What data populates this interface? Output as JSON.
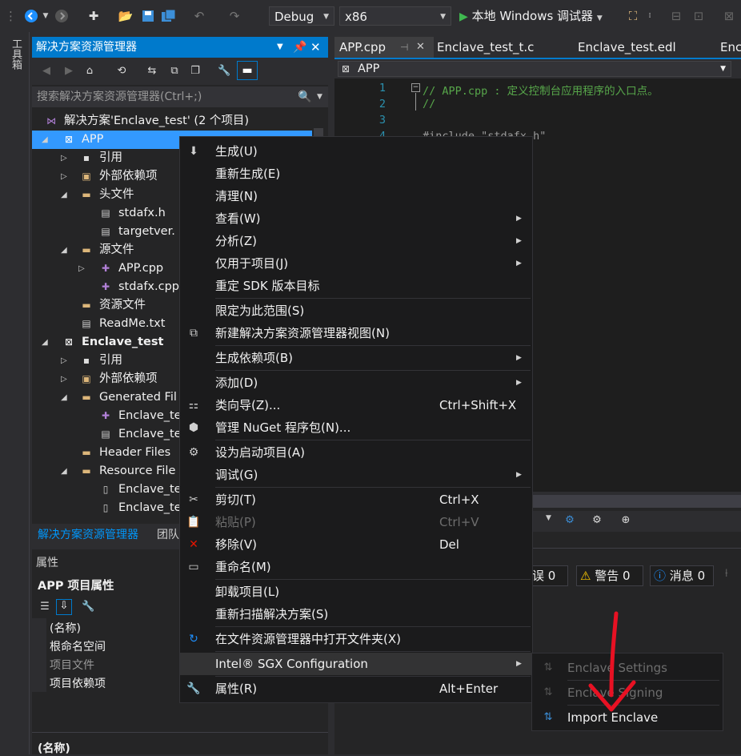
{
  "toolbar": {
    "config": "Debug",
    "platform": "x86",
    "run_label": "本地 Windows 调试器"
  },
  "leftstrip": {
    "label": "工具箱"
  },
  "solution_explorer": {
    "title": "解决方案资源管理器",
    "search_placeholder": "搜索解决方案资源管理器(Ctrl+;)",
    "tree": [
      {
        "label": "解决方案'Enclave_test' (2 个项目)",
        "icon": "solution-icon"
      },
      {
        "label": "APP",
        "icon": "project-icon",
        "selected": true
      },
      {
        "label": "引用",
        "icon": "references-icon"
      },
      {
        "label": "外部依赖项",
        "icon": "external-deps-icon"
      },
      {
        "label": "头文件",
        "icon": "folder-icon"
      },
      {
        "label": "stdafx.h",
        "icon": "header-file-icon"
      },
      {
        "label": "targetver.",
        "icon": "header-file-icon"
      },
      {
        "label": "源文件",
        "icon": "folder-icon"
      },
      {
        "label": "APP.cpp",
        "icon": "cpp-file-icon"
      },
      {
        "label": "stdafx.cpp",
        "icon": "cpp-file-icon"
      },
      {
        "label": "资源文件",
        "icon": "folder-icon"
      },
      {
        "label": "ReadMe.txt",
        "icon": "text-file-icon"
      },
      {
        "label": "Enclave_test",
        "icon": "project-icon"
      },
      {
        "label": "引用",
        "icon": "references-icon"
      },
      {
        "label": "外部依赖项",
        "icon": "external-deps-icon"
      },
      {
        "label": "Generated Fil",
        "icon": "folder-icon"
      },
      {
        "label": "Enclave_te",
        "icon": "cpp-file-icon"
      },
      {
        "label": "Enclave_te",
        "icon": "header-file-icon"
      },
      {
        "label": "Header Files",
        "icon": "folder-icon"
      },
      {
        "label": "Resource File",
        "icon": "folder-icon"
      },
      {
        "label": "Enclave_te",
        "icon": "file-icon"
      },
      {
        "label": "Enclave_te",
        "icon": "file-icon"
      }
    ],
    "tabs": [
      "解决方案资源管理器",
      "团队"
    ]
  },
  "properties": {
    "title": "属性",
    "subject": "APP 项目属性",
    "rows": [
      "(名称)",
      "根命名空间",
      "项目文件",
      "项目依赖项"
    ],
    "footer": "(名称)"
  },
  "editor": {
    "tabs": [
      "APP.cpp",
      "Enclave_test_t.c",
      "Enclave_test.edl",
      "Enc"
    ],
    "scope": "APP",
    "line_numbers": [
      "1",
      "2",
      "3",
      "4"
    ],
    "lines": [
      "// APP.cpp : 定义控制台应用程序的入口点。",
      "//",
      "",
      "#include \"stdafx.h\""
    ]
  },
  "error_list": {
    "errors": "误 0",
    "warnings": "警告 0",
    "messages": "消息 0"
  },
  "context_menu": [
    {
      "label": "生成(U)",
      "icon": "build-icon"
    },
    {
      "label": "重新生成(E)"
    },
    {
      "label": "清理(N)"
    },
    {
      "label": "查看(W)",
      "submenu": true
    },
    {
      "label": "分析(Z)",
      "submenu": true
    },
    {
      "label": "仅用于项目(J)",
      "submenu": true
    },
    {
      "label": "重定 SDK 版本目标"
    },
    {
      "sep": true
    },
    {
      "label": "限定为此范围(S)"
    },
    {
      "label": "新建解决方案资源管理器视图(N)",
      "icon": "new-view-icon"
    },
    {
      "sep": true
    },
    {
      "label": "生成依赖项(B)",
      "submenu": true
    },
    {
      "sep": true
    },
    {
      "label": "添加(D)",
      "submenu": true
    },
    {
      "label": "类向导(Z)...",
      "shortcut": "Ctrl+Shift+X",
      "icon": "class-wizard-icon"
    },
    {
      "label": "管理 NuGet 程序包(N)...",
      "icon": "nuget-icon"
    },
    {
      "sep": true
    },
    {
      "label": "设为启动项目(A)",
      "icon": "gear-icon"
    },
    {
      "label": "调试(G)",
      "submenu": true
    },
    {
      "sep": true
    },
    {
      "label": "剪切(T)",
      "shortcut": "Ctrl+X",
      "icon": "scissors-icon"
    },
    {
      "label": "粘贴(P)",
      "shortcut": "Ctrl+V",
      "icon": "paste-icon",
      "disabled": true
    },
    {
      "label": "移除(V)",
      "shortcut": "Del",
      "icon": "remove-icon"
    },
    {
      "label": "重命名(M)",
      "icon": "rename-icon"
    },
    {
      "sep": true
    },
    {
      "label": "卸载项目(L)"
    },
    {
      "label": "重新扫描解决方案(S)"
    },
    {
      "sep": true
    },
    {
      "label": "在文件资源管理器中打开文件夹(X)",
      "icon": "open-folder-icon"
    },
    {
      "sep": true
    },
    {
      "label": "Intel® SGX Configuration",
      "submenu": true,
      "highlighted": true
    },
    {
      "sep": true
    },
    {
      "label": "属性(R)",
      "shortcut": "Alt+Enter",
      "icon": "wrench-icon"
    }
  ],
  "sgx_submenu": [
    {
      "label": "Enclave Settings",
      "disabled": true
    },
    {
      "label": "Enclave Signing",
      "disabled": true
    },
    {
      "label": "Import Enclave",
      "disabled": false
    }
  ],
  "colors": {
    "accent": "#007acc",
    "selection": "#3399ff",
    "annotation_arrow": "#e81123"
  }
}
